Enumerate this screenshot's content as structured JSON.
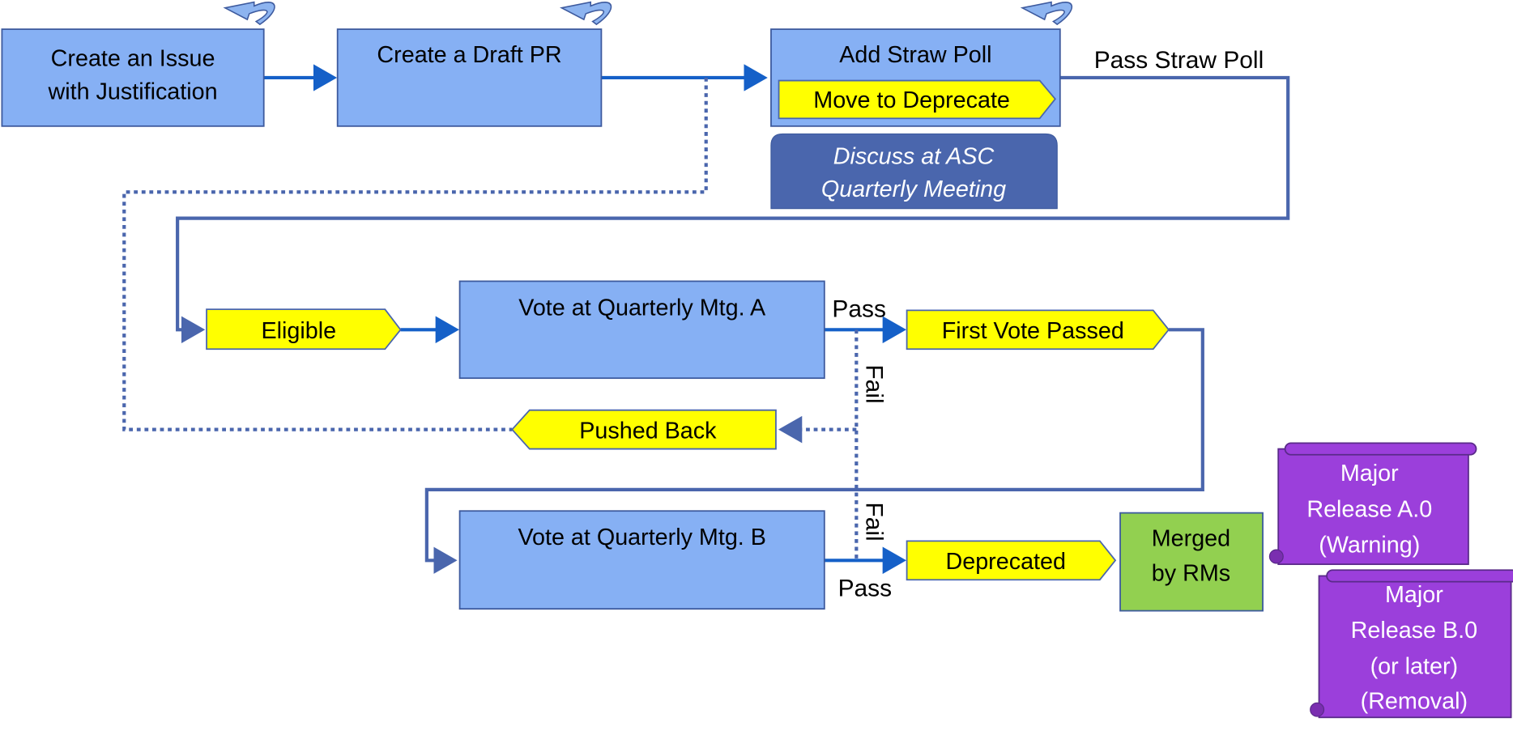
{
  "nodes": {
    "create_issue": [
      "Create an Issue",
      "with Justification"
    ],
    "draft_pr": "Create a Draft PR",
    "straw_poll": "Add Straw Poll",
    "move_to_deprecate": "Move to Deprecate",
    "discuss": [
      "Discuss at ASC",
      "Quarterly Meeting"
    ],
    "eligible": "Eligible",
    "vote_a": "Vote at Quarterly Mtg. A",
    "first_vote_passed": "First Vote Passed",
    "pushed_back": "Pushed Back",
    "vote_b": "Vote at Quarterly Mtg. B",
    "deprecated": "Deprecated",
    "merged": [
      "Merged",
      "by RMs"
    ],
    "release_a": [
      "Major",
      "Release A.0",
      "(Warning)"
    ],
    "release_b": [
      "Major",
      "Release B.0",
      "(or later)",
      "(Removal)"
    ]
  },
  "edge_labels": {
    "pass_straw_poll": "Pass Straw Poll",
    "pass_a": "Pass",
    "fail_a": "Fail",
    "fail_b": "Fail",
    "pass_b": "Pass"
  },
  "colors": {
    "process_box": "#86b0f4",
    "status_tag": "#ffff00",
    "meeting_box": "#4a66ad",
    "merged_box": "#92d050",
    "release_scroll": "#9b3fdb",
    "connector": "#4a66ad",
    "arrow": "#1560c8"
  }
}
